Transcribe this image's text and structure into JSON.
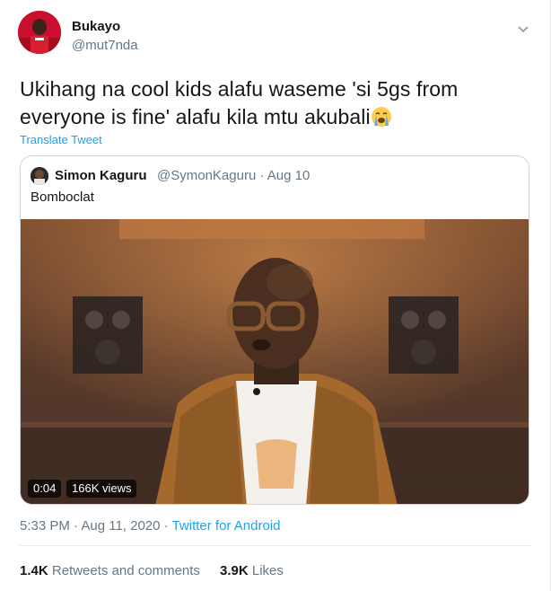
{
  "author": {
    "name": "Bukayo",
    "handle": "@mut7nda"
  },
  "tweet": {
    "text_line1": "Ukihang na cool kids alafu waseme 'si  5gs from",
    "text_line2": "everyone is fine' alafu kila mtu akubali",
    "emoji": "loudly-crying-face",
    "translate_label": "Translate Tweet"
  },
  "quoted": {
    "name": "Simon Kaguru",
    "handle_and_date": "@SymonKaguru · Aug 10",
    "text": "Bomboclat",
    "video": {
      "duration": "0:04",
      "views": "166K views"
    }
  },
  "meta": {
    "time_date": "5:33 PM · Aug 11, 2020 ·",
    "source": "Twitter for Android"
  },
  "stats": {
    "retweets_count": "1.4K",
    "retweets_label": "Retweets and comments",
    "likes_count": "3.9K",
    "likes_label": "Likes"
  },
  "colors": {
    "link": "#1da1f2",
    "secondary_text": "#657786",
    "primary_text": "#14171a",
    "border": "#ccd6dd"
  }
}
